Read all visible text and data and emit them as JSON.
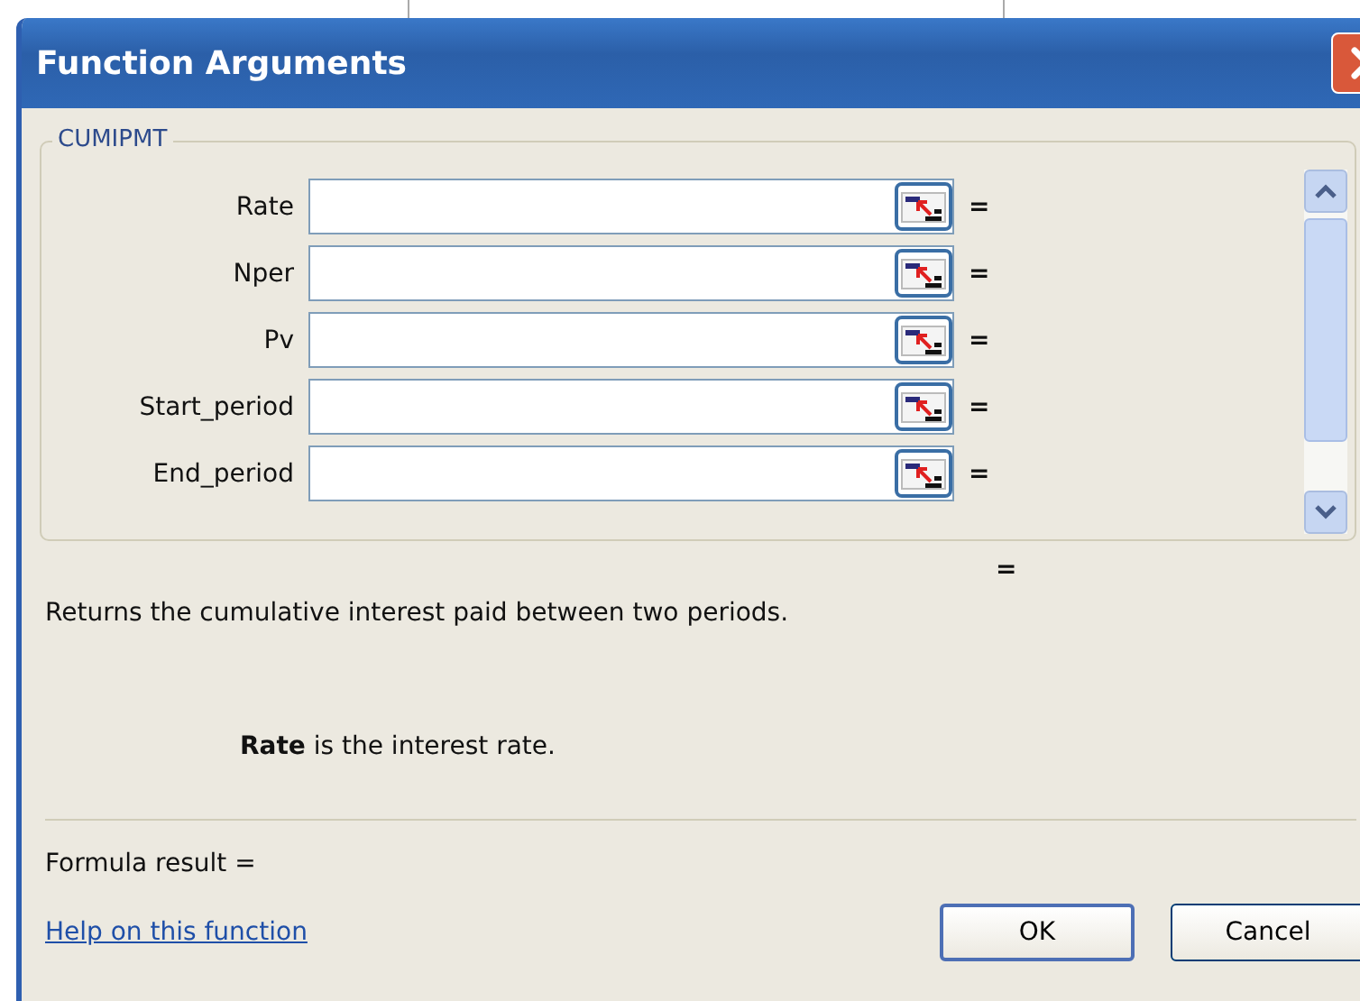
{
  "window": {
    "title": "Function Arguments"
  },
  "function_group": {
    "name": "CUMIPMT",
    "arguments": [
      {
        "label": "Rate",
        "result": "="
      },
      {
        "label": "Nper",
        "result": "="
      },
      {
        "label": "Pv",
        "result": "="
      },
      {
        "label": "Start_period",
        "result": "="
      },
      {
        "label": "End_period",
        "result": "="
      }
    ]
  },
  "function_value": "=",
  "description": "Returns the cumulative interest paid between two periods.",
  "argument_help": "**Rate** is the interest rate.",
  "formula_result": "Formula result =",
  "help_link": "Help on this function",
  "buttons": [
    {
      "label": "OK",
      "default": true
    },
    {
      "label": "Cancel",
      "default": false
    }
  ]
}
